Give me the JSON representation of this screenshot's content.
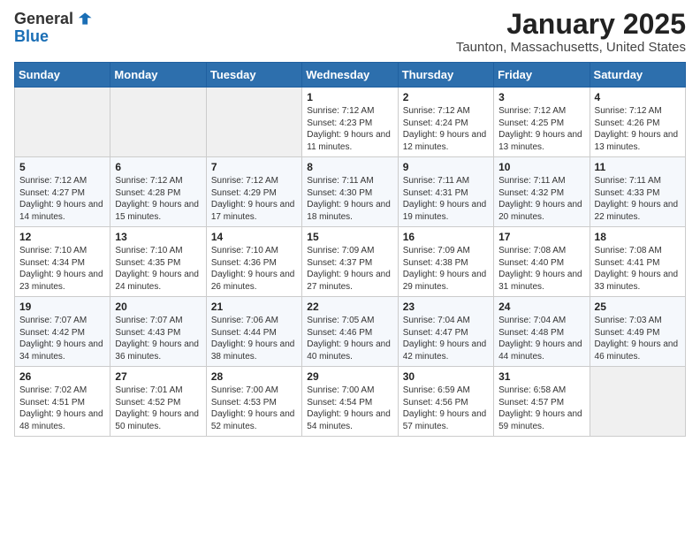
{
  "logo": {
    "general": "General",
    "blue": "Blue"
  },
  "title": "January 2025",
  "subtitle": "Taunton, Massachusetts, United States",
  "days_of_week": [
    "Sunday",
    "Monday",
    "Tuesday",
    "Wednesday",
    "Thursday",
    "Friday",
    "Saturday"
  ],
  "weeks": [
    [
      {
        "day": "",
        "sunrise": "",
        "sunset": "",
        "daylight": "",
        "empty": true
      },
      {
        "day": "",
        "sunrise": "",
        "sunset": "",
        "daylight": "",
        "empty": true
      },
      {
        "day": "",
        "sunrise": "",
        "sunset": "",
        "daylight": "",
        "empty": true
      },
      {
        "day": "1",
        "sunrise": "Sunrise: 7:12 AM",
        "sunset": "Sunset: 4:23 PM",
        "daylight": "Daylight: 9 hours and 11 minutes."
      },
      {
        "day": "2",
        "sunrise": "Sunrise: 7:12 AM",
        "sunset": "Sunset: 4:24 PM",
        "daylight": "Daylight: 9 hours and 12 minutes."
      },
      {
        "day": "3",
        "sunrise": "Sunrise: 7:12 AM",
        "sunset": "Sunset: 4:25 PM",
        "daylight": "Daylight: 9 hours and 13 minutes."
      },
      {
        "day": "4",
        "sunrise": "Sunrise: 7:12 AM",
        "sunset": "Sunset: 4:26 PM",
        "daylight": "Daylight: 9 hours and 13 minutes."
      }
    ],
    [
      {
        "day": "5",
        "sunrise": "Sunrise: 7:12 AM",
        "sunset": "Sunset: 4:27 PM",
        "daylight": "Daylight: 9 hours and 14 minutes."
      },
      {
        "day": "6",
        "sunrise": "Sunrise: 7:12 AM",
        "sunset": "Sunset: 4:28 PM",
        "daylight": "Daylight: 9 hours and 15 minutes."
      },
      {
        "day": "7",
        "sunrise": "Sunrise: 7:12 AM",
        "sunset": "Sunset: 4:29 PM",
        "daylight": "Daylight: 9 hours and 17 minutes."
      },
      {
        "day": "8",
        "sunrise": "Sunrise: 7:11 AM",
        "sunset": "Sunset: 4:30 PM",
        "daylight": "Daylight: 9 hours and 18 minutes."
      },
      {
        "day": "9",
        "sunrise": "Sunrise: 7:11 AM",
        "sunset": "Sunset: 4:31 PM",
        "daylight": "Daylight: 9 hours and 19 minutes."
      },
      {
        "day": "10",
        "sunrise": "Sunrise: 7:11 AM",
        "sunset": "Sunset: 4:32 PM",
        "daylight": "Daylight: 9 hours and 20 minutes."
      },
      {
        "day": "11",
        "sunrise": "Sunrise: 7:11 AM",
        "sunset": "Sunset: 4:33 PM",
        "daylight": "Daylight: 9 hours and 22 minutes."
      }
    ],
    [
      {
        "day": "12",
        "sunrise": "Sunrise: 7:10 AM",
        "sunset": "Sunset: 4:34 PM",
        "daylight": "Daylight: 9 hours and 23 minutes."
      },
      {
        "day": "13",
        "sunrise": "Sunrise: 7:10 AM",
        "sunset": "Sunset: 4:35 PM",
        "daylight": "Daylight: 9 hours and 24 minutes."
      },
      {
        "day": "14",
        "sunrise": "Sunrise: 7:10 AM",
        "sunset": "Sunset: 4:36 PM",
        "daylight": "Daylight: 9 hours and 26 minutes."
      },
      {
        "day": "15",
        "sunrise": "Sunrise: 7:09 AM",
        "sunset": "Sunset: 4:37 PM",
        "daylight": "Daylight: 9 hours and 27 minutes."
      },
      {
        "day": "16",
        "sunrise": "Sunrise: 7:09 AM",
        "sunset": "Sunset: 4:38 PM",
        "daylight": "Daylight: 9 hours and 29 minutes."
      },
      {
        "day": "17",
        "sunrise": "Sunrise: 7:08 AM",
        "sunset": "Sunset: 4:40 PM",
        "daylight": "Daylight: 9 hours and 31 minutes."
      },
      {
        "day": "18",
        "sunrise": "Sunrise: 7:08 AM",
        "sunset": "Sunset: 4:41 PM",
        "daylight": "Daylight: 9 hours and 33 minutes."
      }
    ],
    [
      {
        "day": "19",
        "sunrise": "Sunrise: 7:07 AM",
        "sunset": "Sunset: 4:42 PM",
        "daylight": "Daylight: 9 hours and 34 minutes."
      },
      {
        "day": "20",
        "sunrise": "Sunrise: 7:07 AM",
        "sunset": "Sunset: 4:43 PM",
        "daylight": "Daylight: 9 hours and 36 minutes."
      },
      {
        "day": "21",
        "sunrise": "Sunrise: 7:06 AM",
        "sunset": "Sunset: 4:44 PM",
        "daylight": "Daylight: 9 hours and 38 minutes."
      },
      {
        "day": "22",
        "sunrise": "Sunrise: 7:05 AM",
        "sunset": "Sunset: 4:46 PM",
        "daylight": "Daylight: 9 hours and 40 minutes."
      },
      {
        "day": "23",
        "sunrise": "Sunrise: 7:04 AM",
        "sunset": "Sunset: 4:47 PM",
        "daylight": "Daylight: 9 hours and 42 minutes."
      },
      {
        "day": "24",
        "sunrise": "Sunrise: 7:04 AM",
        "sunset": "Sunset: 4:48 PM",
        "daylight": "Daylight: 9 hours and 44 minutes."
      },
      {
        "day": "25",
        "sunrise": "Sunrise: 7:03 AM",
        "sunset": "Sunset: 4:49 PM",
        "daylight": "Daylight: 9 hours and 46 minutes."
      }
    ],
    [
      {
        "day": "26",
        "sunrise": "Sunrise: 7:02 AM",
        "sunset": "Sunset: 4:51 PM",
        "daylight": "Daylight: 9 hours and 48 minutes."
      },
      {
        "day": "27",
        "sunrise": "Sunrise: 7:01 AM",
        "sunset": "Sunset: 4:52 PM",
        "daylight": "Daylight: 9 hours and 50 minutes."
      },
      {
        "day": "28",
        "sunrise": "Sunrise: 7:00 AM",
        "sunset": "Sunset: 4:53 PM",
        "daylight": "Daylight: 9 hours and 52 minutes."
      },
      {
        "day": "29",
        "sunrise": "Sunrise: 7:00 AM",
        "sunset": "Sunset: 4:54 PM",
        "daylight": "Daylight: 9 hours and 54 minutes."
      },
      {
        "day": "30",
        "sunrise": "Sunrise: 6:59 AM",
        "sunset": "Sunset: 4:56 PM",
        "daylight": "Daylight: 9 hours and 57 minutes."
      },
      {
        "day": "31",
        "sunrise": "Sunrise: 6:58 AM",
        "sunset": "Sunset: 4:57 PM",
        "daylight": "Daylight: 9 hours and 59 minutes."
      },
      {
        "day": "",
        "sunrise": "",
        "sunset": "",
        "daylight": "",
        "empty": true
      }
    ]
  ]
}
